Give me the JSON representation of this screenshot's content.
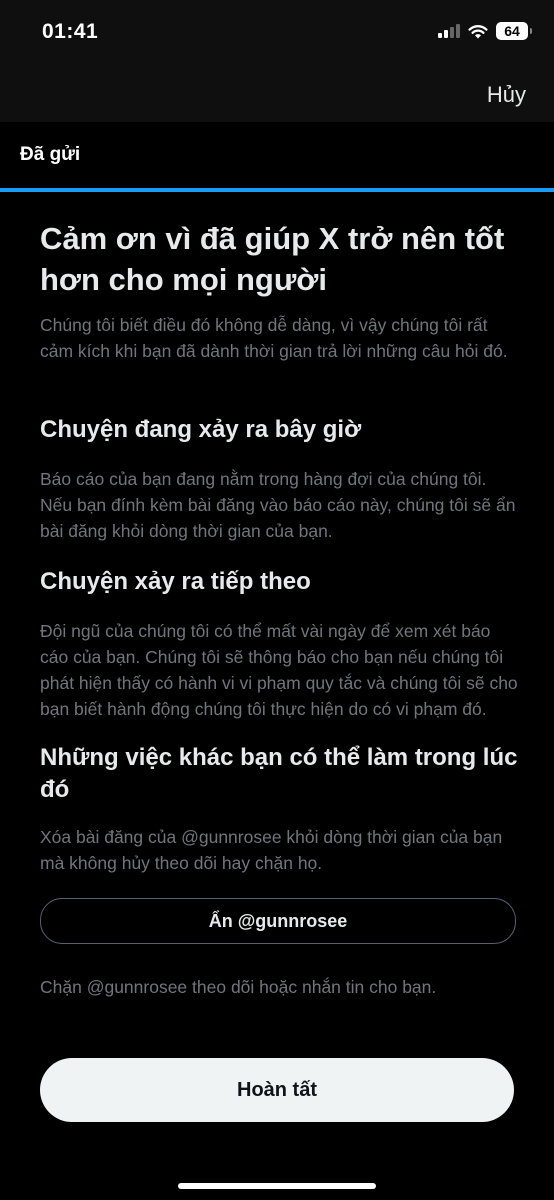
{
  "status_bar": {
    "time": "01:41",
    "battery": "64",
    "signal_icon": "cellular-signal-icon",
    "wifi_icon": "wifi-icon"
  },
  "header": {
    "cancel_label": "Hủy"
  },
  "tab": {
    "title": "Đã gửi"
  },
  "main": {
    "title": "Cảm ơn vì đã giúp X trở nên tốt hơn cho mọi người",
    "intro": "Chúng tôi biết điều đó không dễ dàng, vì vậy chúng tôi rất cảm kích khi bạn đã dành thời gian trả lời những câu hỏi đó.",
    "sections": [
      {
        "heading": "Chuyện đang xảy ra bây giờ",
        "body": "Báo cáo của bạn đang nằm trong hàng đợi của chúng tôi. Nếu bạn đính kèm bài đăng vào báo cáo này, chúng tôi sẽ ẩn bài đăng khỏi dòng thời gian của bạn."
      },
      {
        "heading": "Chuyện xảy ra tiếp theo",
        "body": "Đội ngũ của chúng tôi có thể mất vài ngày để xem xét báo cáo của bạn. Chúng tôi sẽ thông báo cho bạn nếu chúng tôi phát hiện thấy có hành vi vi phạm quy tắc và chúng tôi sẽ cho bạn biết hành động chúng tôi thực hiện do có vi phạm đó."
      },
      {
        "heading": "Những việc khác bạn có thể làm trong lúc đó",
        "body": "Xóa bài đăng của @gunnrosee khỏi dòng thời gian của bạn mà không hủy theo dõi hay chặn họ."
      }
    ],
    "hide_button_label": "Ẩn @gunnrosee",
    "block_text": "Chặn @gunnrosee theo dõi hoặc nhắn tin cho bạn.",
    "done_button_label": "Hoàn tất"
  },
  "colors": {
    "accent": "#1d9bf0",
    "background": "#000000",
    "primary_text": "#e7e9ea",
    "secondary_text": "#71767b"
  }
}
